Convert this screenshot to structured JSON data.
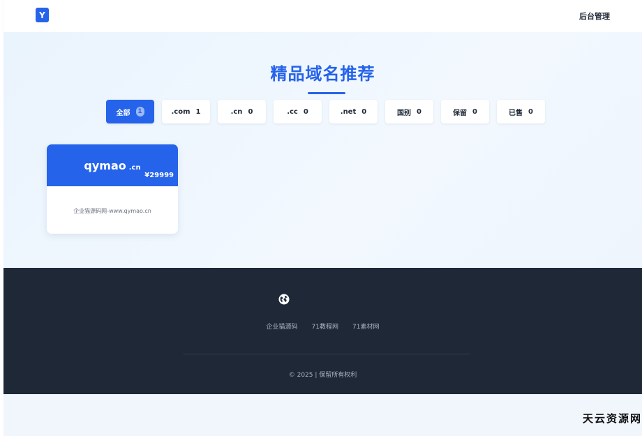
{
  "header": {
    "logo_letter": "Y",
    "admin_label": "后台管理"
  },
  "hero": {
    "title": "精品域名推荐"
  },
  "tabs": [
    {
      "label": "全部",
      "count": "1",
      "active": true
    },
    {
      "label": ".com",
      "count": "1"
    },
    {
      "label": ".cn",
      "count": "0"
    },
    {
      "label": ".cc",
      "count": "0"
    },
    {
      "label": ".net",
      "count": "0"
    },
    {
      "label": "国别",
      "count": "0"
    },
    {
      "label": "保留",
      "count": "0"
    },
    {
      "label": "已售",
      "count": "0"
    }
  ],
  "card": {
    "name": "qymao",
    "tld": ".cn",
    "price": "¥29999",
    "description": "企业猫源码网-www.qymao.cn"
  },
  "footer": {
    "icon": "globe-icon",
    "links": [
      "企业猫源码",
      "71教程网",
      "71素材网"
    ],
    "copyright": "© 2025 | 保留所有权利"
  },
  "watermark": "天云资源网",
  "colors": {
    "accent": "#2563eb",
    "footer_bg": "#1e2837"
  }
}
